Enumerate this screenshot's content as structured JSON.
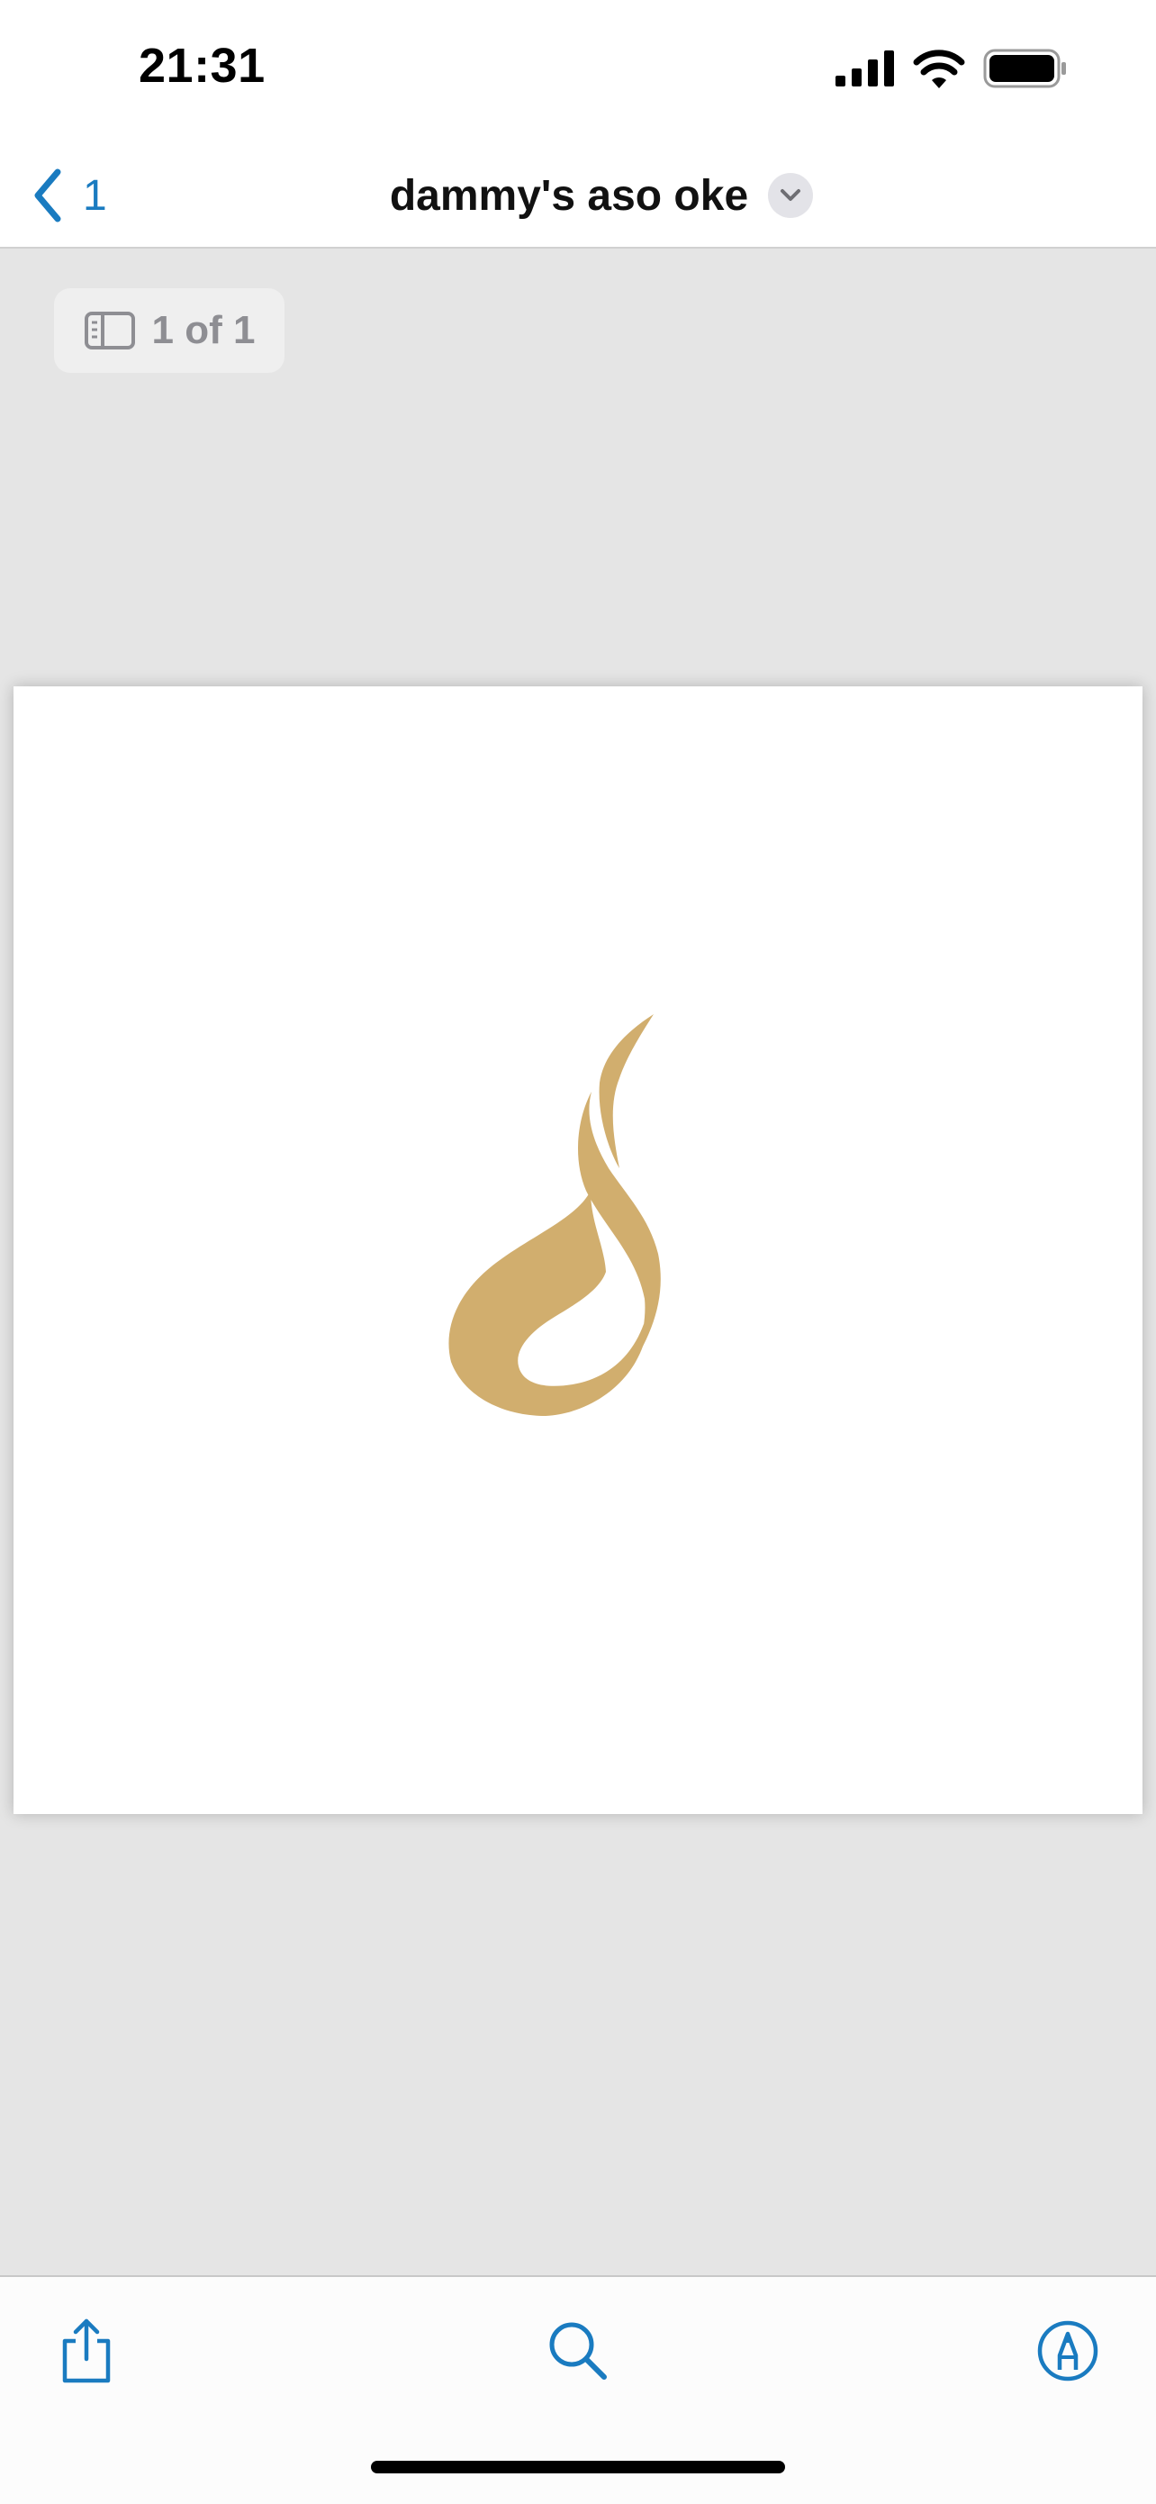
{
  "status_bar": {
    "time": "21:31"
  },
  "nav": {
    "back_count": "1",
    "title": "dammy's aso oke"
  },
  "page_indicator": {
    "text": "1 of 1"
  },
  "colors": {
    "accent": "#1a7bc0",
    "logo_gold": "#d1ae6e",
    "background": "#e5e5e5"
  },
  "icons": {
    "back": "chevron-left-icon",
    "title_menu": "chevron-down-icon",
    "thumbnails": "sidebar-icon",
    "share": "share-icon",
    "search": "search-icon",
    "markup": "markup-pen-icon"
  }
}
